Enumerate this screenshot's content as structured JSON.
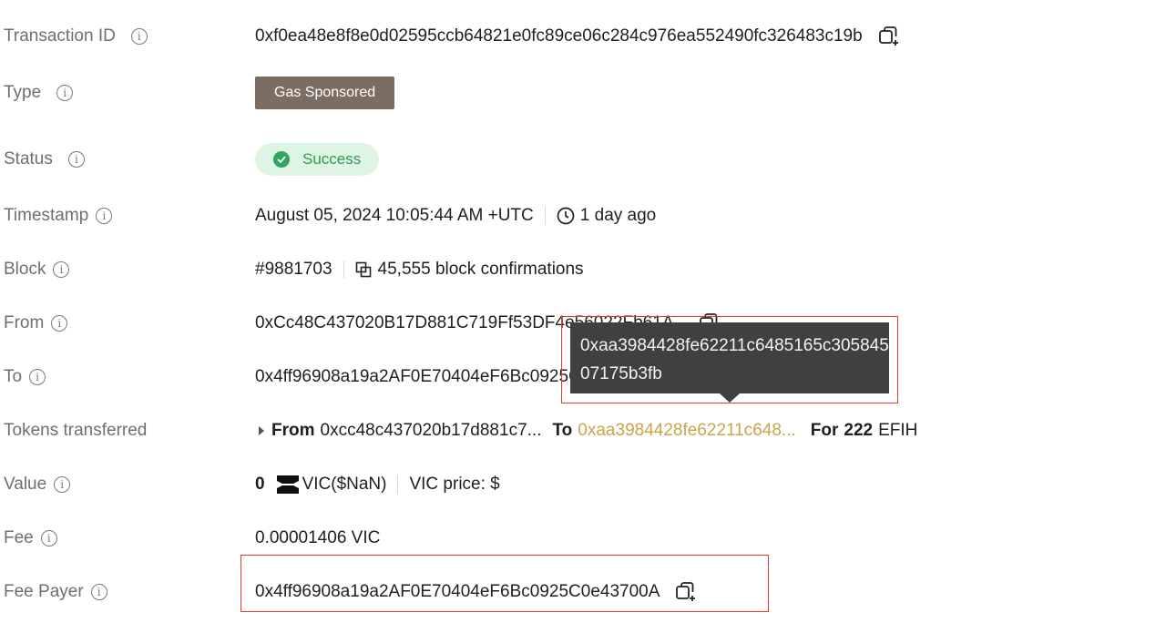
{
  "rows": {
    "txid": {
      "label": "Transaction ID",
      "value": "0xf0ea48e8f8e0d02595ccb64821e0fc89ce06c284c976ea552490fc326483c19b"
    },
    "type": {
      "label": "Type",
      "value": "Gas Sponsored"
    },
    "status": {
      "label": "Status",
      "value": "Success"
    },
    "timestamp": {
      "label": "Timestamp",
      "value": "August 05, 2024 10:05:44 AM +UTC",
      "ago": "1 day ago"
    },
    "block": {
      "label": "Block",
      "value": "#9881703",
      "confirmations": "45,555 block confirmations"
    },
    "from": {
      "label": "From",
      "value": "0xCc48C437020B17D881C719Ff53DF4e56022Fb61A"
    },
    "to": {
      "label": "To",
      "value": "0x4ff96908a19a2AF0E70404eF6Bc0925C0e43700A"
    },
    "tokens": {
      "label": "Tokens transferred",
      "from_kw": "From",
      "from_addr": "0xcc48c437020b17d881c7...",
      "to_kw": "To",
      "to_addr": "0xaa3984428fe62211c648...",
      "for_kw": "For",
      "amount": "222",
      "token": "EFIH"
    },
    "value": {
      "label": "Value",
      "amount": "0",
      "symbol": "VIC($NaN)",
      "price": "VIC price: $"
    },
    "fee": {
      "label": "Fee",
      "value": "0.00001406 VIC"
    },
    "fee_payer": {
      "label": "Fee Payer",
      "value": "0x4ff96908a19a2AF0E70404eF6Bc0925C0e43700A"
    }
  },
  "tooltip": {
    "text": "0xaa3984428fe62211c6485165c30584507175b3fb"
  },
  "colors": {
    "type_badge": "#7b6d62",
    "success_bg": "#dff5e4",
    "success_text": "#2f9a52",
    "link_gold": "#c9a44a",
    "highlight_box": "#e23a2a"
  },
  "icons": [
    "info-icon",
    "copy-icon",
    "check-circle-icon",
    "clock-icon",
    "block-icon",
    "vic-logo-icon"
  ]
}
